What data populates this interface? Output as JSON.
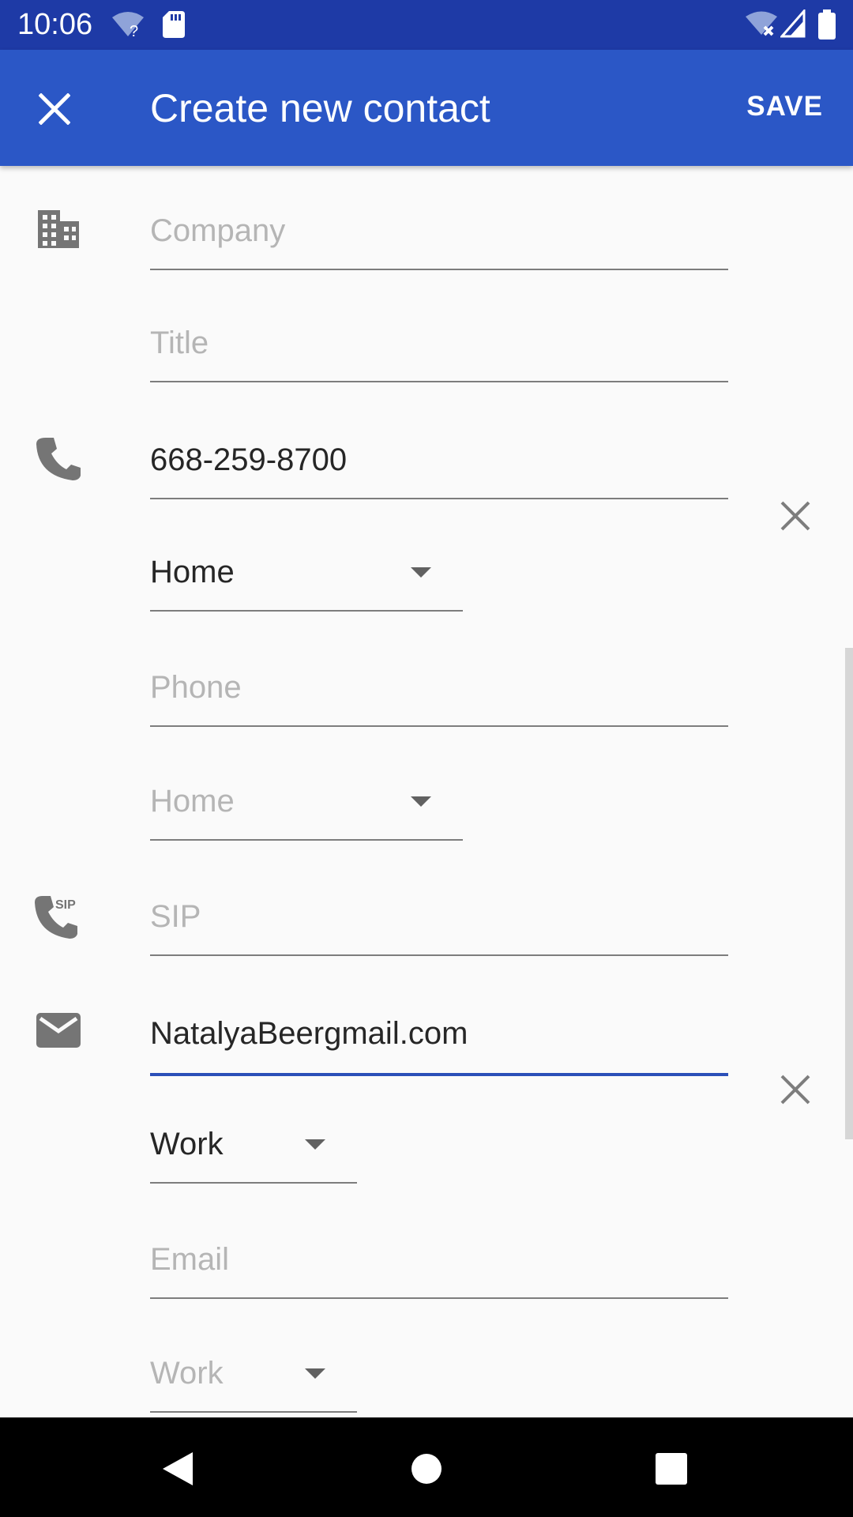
{
  "status_bar": {
    "time": "10:06",
    "icons": [
      "wifi-question-icon",
      "sd-card-icon",
      "wifi-off-icon",
      "signal-icon",
      "battery-icon"
    ]
  },
  "app_bar": {
    "title": "Create new contact",
    "save_label": "SAVE",
    "close_icon": "close-icon"
  },
  "fields": {
    "company": {
      "placeholder": "Company",
      "value": ""
    },
    "title": {
      "placeholder": "Title",
      "value": ""
    },
    "phone1": {
      "value": "668-259-8700",
      "type": "Home"
    },
    "phone2": {
      "placeholder": "Phone",
      "type": "Home"
    },
    "sip": {
      "placeholder": "SIP",
      "value": ""
    },
    "email1": {
      "value": "NatalyaBeergmail.com",
      "type": "Work"
    },
    "email2": {
      "placeholder": "Email",
      "type": "Work"
    }
  },
  "icons": {
    "company": "building-icon",
    "phone": "phone-icon",
    "sip": "sip-phone-icon",
    "email": "email-icon"
  },
  "sip_badge": "SIP",
  "colors": {
    "status_bar": "#1e3aa6",
    "app_bar": "#2b57c6",
    "focus_accent": "#2b4fb8"
  },
  "nav": [
    "back-icon",
    "home-icon",
    "recents-icon"
  ]
}
